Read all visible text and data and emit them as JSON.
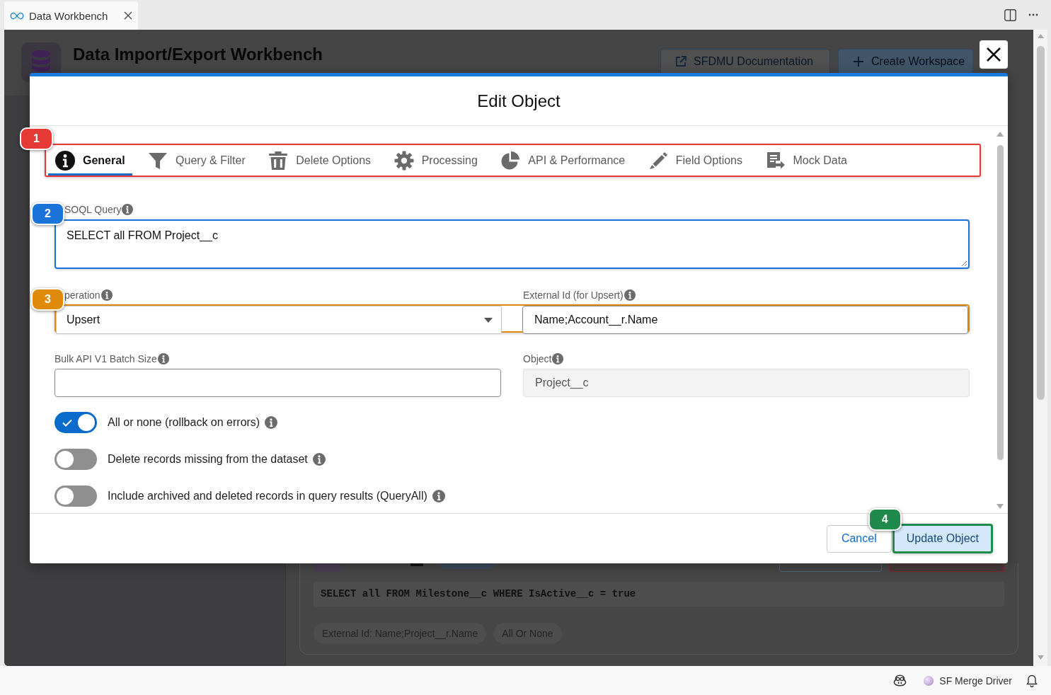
{
  "editor_tab": {
    "title": "Data Workbench"
  },
  "workbench": {
    "title": "Data Import/Export Workbench",
    "buttons": [
      {
        "label": "SFDMU Documentation",
        "kind": "outline"
      },
      {
        "label": "Create Workspace",
        "kind": "primary"
      }
    ],
    "object_card": {
      "query": "SELECT all FROM Milestone__c WHERE IsActive__c = true",
      "tags": [
        "External Id: Name;Project__r.Name",
        "All Or None"
      ]
    }
  },
  "modal": {
    "title": "Edit Object",
    "tab_bar": {
      "callout": {
        "number": "1",
        "color": "#e53935"
      },
      "tabs": [
        {
          "label": "General",
          "selected": true
        },
        {
          "label": "Query & Filter",
          "selected": false
        },
        {
          "label": "Delete Options",
          "selected": false
        },
        {
          "label": "Processing",
          "selected": false
        },
        {
          "label": "API & Performance",
          "selected": false
        },
        {
          "label": "Field Options",
          "selected": false
        },
        {
          "label": "Mock Data",
          "selected": false
        }
      ]
    },
    "soql_query": {
      "label": "SOQL Query",
      "value": "SELECT all FROM Project__c",
      "callout": {
        "number": "2",
        "color": "#1a73d8"
      }
    },
    "operation_row": {
      "callout": {
        "number": "3",
        "color": "#e08a0b"
      },
      "operation": {
        "label": "peration",
        "value": "Upsert"
      },
      "external_id": {
        "label": "External Id (for Upsert)",
        "value": "Name;Account__r.Name"
      }
    },
    "batch_size": {
      "label": "Bulk API V1 Batch Size"
    },
    "object": {
      "label": "Object",
      "value": "Project__c",
      "disabled": true
    },
    "toggles": [
      {
        "label": "All or none (rollback on errors)",
        "on": true
      },
      {
        "label": "Delete records missing from the dataset",
        "on": false
      },
      {
        "label": "Include archived and deleted records in query results (QueryAll)",
        "on": false
      }
    ],
    "buttons": [
      {
        "label": "Cancel",
        "kind": "secondary"
      },
      {
        "label": "Update Object",
        "kind": "primary",
        "callout": {
          "number": "4",
          "color": "#1f8a4c"
        }
      }
    ]
  },
  "status_bar": {
    "extension": "SF Merge Driver"
  }
}
